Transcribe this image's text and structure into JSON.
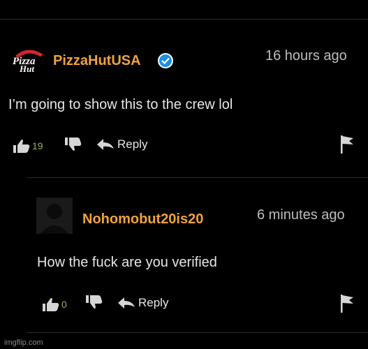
{
  "comments": [
    {
      "username": "PizzaHutUSA",
      "verified": true,
      "timestamp": "16 hours ago",
      "text": "I’m going to show this to the crew lol",
      "likes": "19",
      "reply_label": "Reply",
      "logo_text": [
        "Pizza",
        "Hut"
      ],
      "colors": {
        "likes": "#9fb24a"
      }
    },
    {
      "username": "Nohomobut20is20",
      "verified": false,
      "timestamp": "6 minutes ago",
      "text": "How the fuck are you verified",
      "likes": "0",
      "reply_label": "Reply",
      "colors": {
        "likes": "#9fb24a"
      }
    }
  ],
  "watermark": "imgflip.com",
  "colors": {
    "background": "#000000",
    "username": "#f0a33c",
    "verified_badge": "#1d8fe6",
    "text": "#e6e6e6",
    "timestamp": "#bdbdbd"
  }
}
